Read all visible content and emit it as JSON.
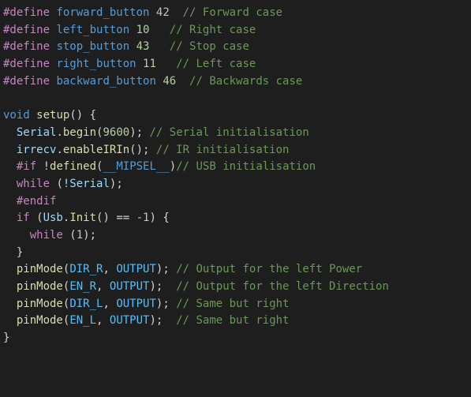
{
  "defines": [
    {
      "name": "forward_button",
      "value": "42",
      "comment": "// Forward case"
    },
    {
      "name": "left_button",
      "value": "10",
      "comment": "// Right case"
    },
    {
      "name": "stop_button",
      "value": "43",
      "comment": "// Stop case"
    },
    {
      "name": "right_button",
      "value": "11",
      "comment": "// Left case"
    },
    {
      "name": "backward_button",
      "value": "46",
      "comment": "// Backwards case"
    }
  ],
  "setup": {
    "ret": "void",
    "name": "setup",
    "serial_obj": "Serial",
    "serial_begin": "begin",
    "baud": "9600",
    "serial_comment": "// Serial initialisation",
    "irrecv_obj": "irrecv",
    "enableIRIn": "enableIRIn",
    "ir_comment": "// IR initialisation",
    "if_dir": "#if",
    "neg": "!",
    "defined": "defined",
    "mipsel": "__MIPSEL__",
    "usb_comment": "// USB initialisation",
    "while_kw": "while",
    "serial_cond": "!Serial",
    "endif": "#endif",
    "if_kw": "if",
    "usb_obj": "Usb",
    "init": "Init",
    "eq": "==",
    "neg1": "-1",
    "one": "1",
    "pinMode": "pinMode",
    "output": "OUTPUT",
    "dir_r": "DIR_R",
    "en_r": "EN_R",
    "dir_l": "DIR_L",
    "en_l": "EN_L",
    "c_left_power": "// Output for the left Power",
    "c_left_dir": "// Output for the left Direction",
    "c_same_r1": "// Same but right",
    "c_same_r2": "// Same but right"
  }
}
